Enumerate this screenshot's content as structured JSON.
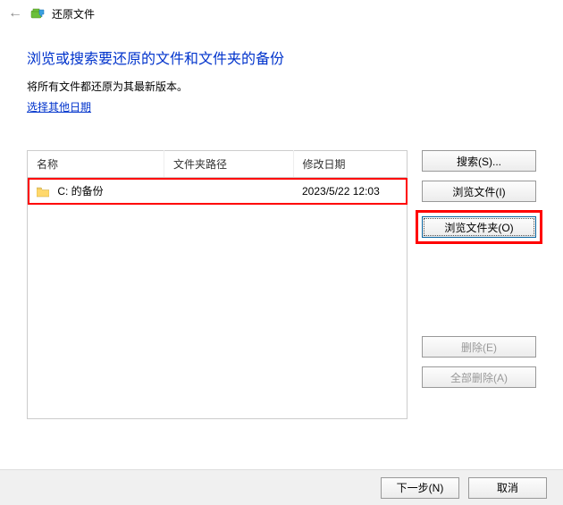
{
  "titlebar": {
    "title": "还原文件"
  },
  "heading": "浏览或搜索要还原的文件和文件夹的备份",
  "subtext": "将所有文件都还原为其最新版本。",
  "link_other_date": "选择其他日期",
  "table": {
    "headers": {
      "name": "名称",
      "folder_path": "文件夹路径",
      "modified": "修改日期"
    },
    "rows": [
      {
        "name": "C: 的备份",
        "folder_path": "",
        "modified": "2023/5/22 12:03"
      }
    ]
  },
  "buttons": {
    "search": "搜索(S)...",
    "browse_files": "浏览文件(I)",
    "browse_folders": "浏览文件夹(O)",
    "delete": "删除(E)",
    "delete_all": "全部删除(A)",
    "next": "下一步(N)",
    "cancel": "取消"
  }
}
